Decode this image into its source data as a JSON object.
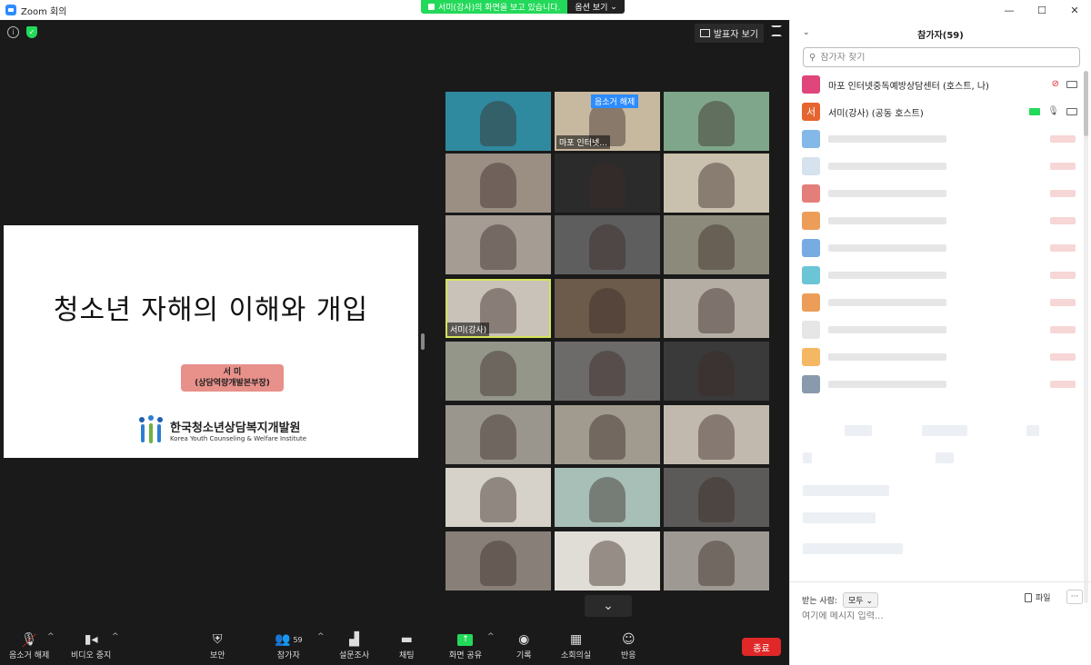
{
  "window": {
    "title": "Zoom 회의",
    "controls": [
      "—",
      "☐",
      "✕"
    ]
  },
  "share_banner": {
    "message": "서미(강사)의 화면을 보고 있습니다.",
    "options_label": "옵션 보기"
  },
  "view": {
    "speaker_view_label": "발표자 보기"
  },
  "slide": {
    "title": "청소년 자해의 이해와 개입",
    "presenter_name": "서 미",
    "presenter_role": "(상담역량개발본부장)",
    "org_name": "한국청소년상담복지개발원",
    "org_english": "Korea Youth Counseling & Welfare Institute"
  },
  "gallery": {
    "tiles": [
      {
        "label": "",
        "color": "#2f8aa0"
      },
      {
        "label": "마포 인터넷...",
        "color": "#c7b9a0",
        "overlay": "음소거 해제"
      },
      {
        "label": "",
        "color": "#7fa68a"
      },
      {
        "label": "",
        "color": "#9b8f84"
      },
      {
        "label": "",
        "color": "#2b2b2b"
      },
      {
        "label": "",
        "color": "#c9c0ae"
      },
      {
        "label": "",
        "color": "#a59c94"
      },
      {
        "label": "",
        "color": "#5e5e5e"
      },
      {
        "label": "",
        "color": "#8c8a7a"
      },
      {
        "label": "서미(강사)",
        "color": "#c8c2b8",
        "active": true
      },
      {
        "label": "",
        "color": "#6c5a4a"
      },
      {
        "label": "",
        "color": "#b4aea4"
      },
      {
        "label": "",
        "color": "#94968a"
      },
      {
        "label": "",
        "color": "#6d6b6a"
      },
      {
        "label": "",
        "color": "#3a3a3a"
      },
      {
        "label": "",
        "color": "#9a958d"
      },
      {
        "label": "",
        "color": "#a19a8e"
      },
      {
        "label": "",
        "color": "#c2b9ae"
      },
      {
        "label": "",
        "color": "#d6d2ca"
      },
      {
        "label": "",
        "color": "#a7bfb7"
      },
      {
        "label": "",
        "color": "#5c5a58"
      },
      {
        "label": "",
        "color": "#888078"
      },
      {
        "label": "",
        "color": "#e0ddd6"
      },
      {
        "label": "",
        "color": "#9e9a93"
      }
    ]
  },
  "toolbar": {
    "unmute": "음소거 해제",
    "video_stop": "비디오 중지",
    "security": "보안",
    "participants": "참가자",
    "participants_count": "59",
    "poll": "설문조사",
    "chat": "채팅",
    "share_screen": "화면 공유",
    "record": "기록",
    "breakout": "소회의실",
    "reactions": "반응",
    "end": "종료"
  },
  "panel": {
    "title": "참가자(59)",
    "search_placeholder": "참가자 찾기",
    "participants": [
      {
        "name": "마포 인터넷중독예방상담센터 (호스트, 나)",
        "avatar": "",
        "avatar_color": "#e0457b",
        "muted": true
      },
      {
        "name": "서미(강사) (공동 호스트)",
        "avatar": "서",
        "avatar_color": "#e6642f",
        "muted": false,
        "sharing": true
      }
    ],
    "blurred_rows": [
      {
        "color": "#5aa0e0"
      },
      {
        "color": "#c8d8e8"
      },
      {
        "color": "#d9534f"
      },
      {
        "color": "#e67e22"
      },
      {
        "color": "#4a90d9"
      },
      {
        "color": "#3bb0c9"
      },
      {
        "color": "#e67e22"
      },
      {
        "color": "#dddddd"
      },
      {
        "color": "#f0a030"
      },
      {
        "color": "#607890"
      }
    ]
  },
  "chat": {
    "to_label": "받는 사람:",
    "to_value": "모두",
    "file_label": "파일",
    "more_label": "···",
    "input_placeholder": "여기에 메시지 입력..."
  }
}
